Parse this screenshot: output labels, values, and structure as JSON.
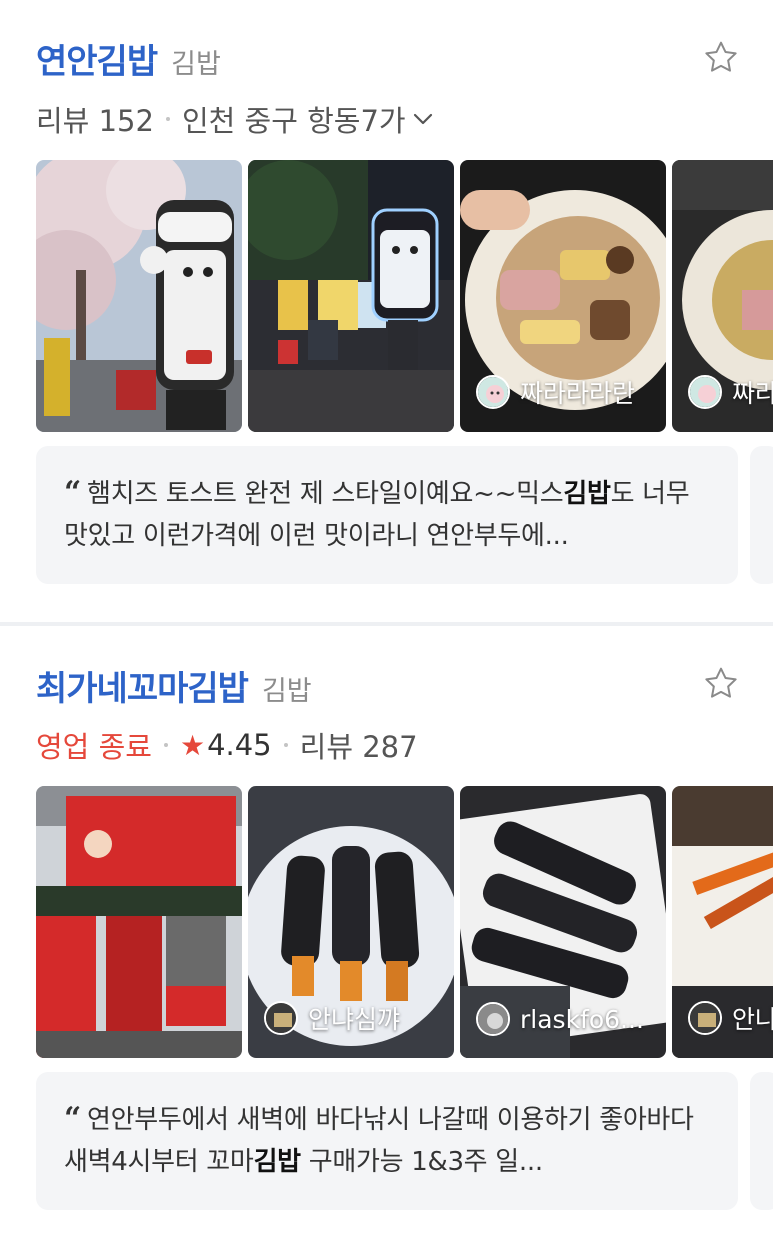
{
  "restaurants": [
    {
      "name": "연안김밥",
      "category": "김밥",
      "review_label": "리뷰 152",
      "address": "인천 중구 항동7가",
      "photos": [
        {
          "author": ""
        },
        {
          "author": ""
        },
        {
          "author": "짜라라라란"
        },
        {
          "author": "짜라"
        }
      ],
      "review": {
        "before": "햄치즈 토스트 완전 제 스타일이예요~~믹스",
        "highlight": "김밥",
        "after": "도 너무 맛있고 이런가격에 이런 맛이라니 연안부두에..."
      }
    },
    {
      "name": "최가네꼬마김밥",
      "category": "김밥",
      "status": "영업 종료",
      "rating": "4.45",
      "review_label": "리뷰 287",
      "photos": [
        {
          "author": ""
        },
        {
          "author": "안냐심꺄"
        },
        {
          "author": "rlaskfo6..."
        },
        {
          "author": "안냐"
        }
      ],
      "review": {
        "before": "연안부두에서 새벽에 바다낚시 나갈때 이용하기 좋아바다 새벽4시부터 꼬마",
        "highlight": "김밥",
        "after": " 구매가능 1&3주 일..."
      }
    }
  ],
  "icons": {
    "favorite": "star-outline-icon",
    "rating": "star-filled-icon",
    "expand": "chevron-down-icon",
    "quote": "quote-icon"
  },
  "colors": {
    "name": "#2d63c8",
    "closed": "#e5483b",
    "review_bg": "#f4f5f7"
  }
}
